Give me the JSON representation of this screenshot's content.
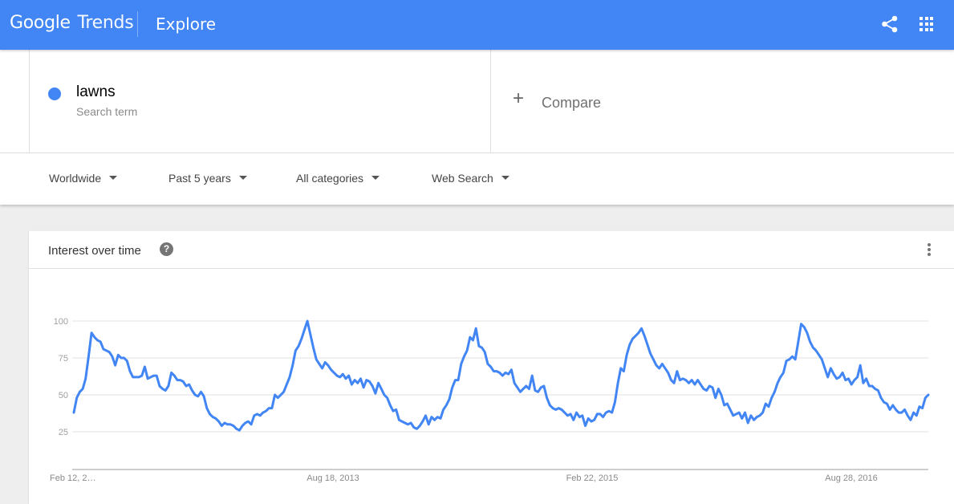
{
  "header": {
    "brand_google": "Google",
    "brand_trends": "Trends",
    "page": "Explore",
    "icons": [
      "share-icon",
      "apps-grid-icon"
    ]
  },
  "search": {
    "term": "lawns",
    "term_type": "Search term",
    "term_color": "#4285f4",
    "compare_label": "Compare",
    "compare_icon": "+"
  },
  "filters": {
    "region": "Worldwide",
    "time": "Past 5 years",
    "category": "All categories",
    "property": "Web Search"
  },
  "card": {
    "title": "Interest over time",
    "help_icon": "?"
  },
  "chart_data": {
    "type": "line",
    "title": "Interest over time",
    "xlabel": "",
    "ylabel": "",
    "ylim": [
      0,
      100
    ],
    "yticks": [
      25,
      50,
      75,
      100
    ],
    "xtick_labels": [
      "Feb 12, 2…",
      "Aug 18, 2013",
      "Feb 22, 2015",
      "Aug 28, 2016"
    ],
    "grid": true,
    "legend": "none",
    "series": [
      {
        "name": "lawns",
        "color": "#4285f4",
        "values": [
          38,
          48,
          52,
          54,
          61,
          76,
          92,
          89,
          87,
          86,
          81,
          80,
          79,
          76,
          70,
          77,
          75,
          75,
          73,
          66,
          62,
          62,
          62,
          63,
          69,
          61,
          62,
          63,
          63,
          56,
          54,
          53,
          56,
          65,
          63,
          60,
          60,
          59,
          56,
          57,
          53,
          50,
          49,
          52,
          49,
          41,
          37,
          35,
          34,
          32,
          29,
          31,
          30,
          30,
          29,
          27,
          26,
          29,
          31,
          32,
          30,
          36,
          37,
          36,
          38,
          39,
          41,
          41,
          50,
          48,
          50,
          52,
          57,
          62,
          70,
          80,
          83,
          88,
          94,
          100,
          91,
          82,
          74,
          71,
          68,
          72,
          70,
          67,
          65,
          63,
          62,
          64,
          61,
          63,
          57,
          60,
          58,
          61,
          55,
          60,
          59,
          56,
          51,
          58,
          54,
          50,
          48,
          43,
          39,
          40,
          33,
          32,
          31,
          30,
          31,
          28,
          27,
          29,
          32,
          36,
          30,
          35,
          33,
          35,
          34,
          40,
          43,
          47,
          55,
          60,
          60,
          71,
          76,
          80,
          89,
          87,
          95,
          83,
          82,
          79,
          71,
          69,
          66,
          66,
          65,
          63,
          65,
          64,
          67,
          58,
          55,
          52,
          54,
          56,
          54,
          63,
          53,
          52,
          55,
          56,
          48,
          43,
          41,
          40,
          41,
          40,
          38,
          36,
          37,
          33,
          38,
          35,
          36,
          29,
          34,
          32,
          33,
          37,
          37,
          35,
          38,
          39,
          38,
          45,
          58,
          68,
          66,
          77,
          84,
          88,
          90,
          92,
          95,
          90,
          84,
          78,
          74,
          70,
          68,
          71,
          68,
          65,
          60,
          58,
          66,
          60,
          61,
          60,
          58,
          60,
          57,
          60,
          57,
          54,
          53,
          56,
          55,
          48,
          54,
          50,
          43,
          44,
          40,
          36,
          37,
          38,
          34,
          38,
          31,
          36,
          33,
          35,
          36,
          38,
          44,
          42,
          48,
          52,
          58,
          62,
          65,
          73,
          74,
          76,
          74,
          86,
          98,
          96,
          92,
          86,
          82,
          80,
          77,
          74,
          68,
          62,
          68,
          64,
          61,
          62,
          65,
          60,
          61,
          57,
          60,
          62,
          70,
          58,
          61,
          56,
          56,
          54,
          53,
          48,
          45,
          44,
          40,
          43,
          40,
          38,
          38,
          40,
          36,
          33,
          38,
          36,
          42,
          41,
          48,
          50
        ]
      }
    ]
  }
}
